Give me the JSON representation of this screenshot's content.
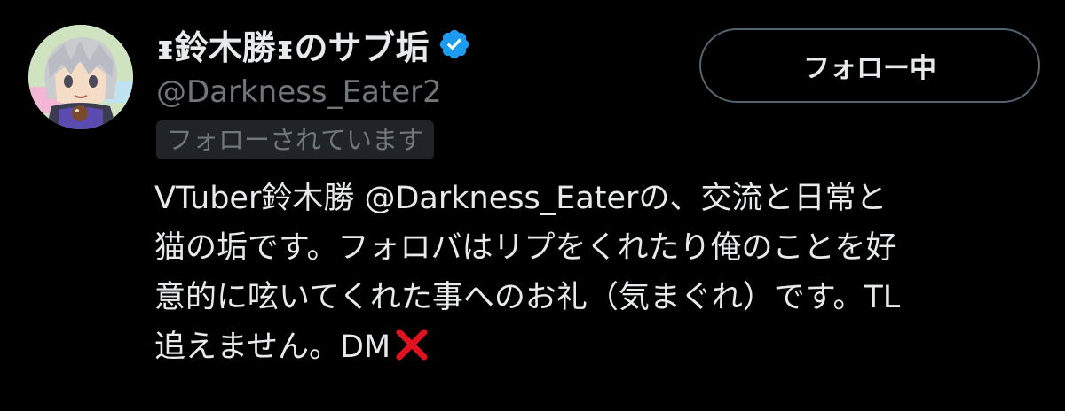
{
  "profile": {
    "display_name": "ᵻ鈴木勝ᵻのサブ垢",
    "handle": "@Darkness_Eater2",
    "follows_you_badge": "フォローされています",
    "verified_icon": "verified-badge-icon",
    "avatar_icon": "anime-character-avatar"
  },
  "actions": {
    "follow_button_label": "フォロー中"
  },
  "bio": {
    "line1_prefix": "VTuber鈴木勝",
    "line1_mention": "@Darkness_Eater",
    "line1_suffix": "の、交流と日常と",
    "line2": "猫の垢です。フォロバはリプをくれたり俺のことを好",
    "line3": "意的に呟いてくれた事へのお礼（気まぐれ）です。TL",
    "line4": "追えません。DM",
    "line4_icon": "red-cross-icon"
  },
  "colors": {
    "background": "#000000",
    "primary_text": "#e7e9ea",
    "secondary_text": "#71767b",
    "badge_background": "#202327",
    "button_border": "#536471",
    "verified_blue": "#1d9bf0",
    "cross_red": "#e0121f"
  }
}
